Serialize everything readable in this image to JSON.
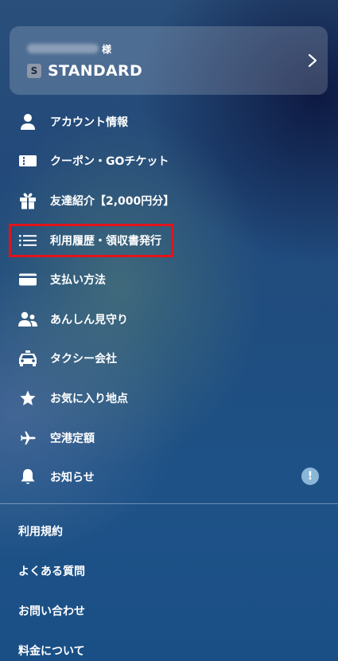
{
  "account": {
    "honorific": "様",
    "plan_badge": "S",
    "plan_name": "STANDARD"
  },
  "menu": {
    "items": [
      {
        "icon": "person-icon",
        "label": "アカウント情報"
      },
      {
        "icon": "ticket-icon",
        "label": "クーポン・GOチケット"
      },
      {
        "icon": "gift-icon",
        "label": "友達紹介【2,000円分】"
      },
      {
        "icon": "list-icon",
        "label": "利用履歴・領収書発行"
      },
      {
        "icon": "credit-card-icon",
        "label": "支払い方法"
      },
      {
        "icon": "people-icon",
        "label": "あんしん見守り"
      },
      {
        "icon": "taxi-icon",
        "label": "タクシー会社"
      },
      {
        "icon": "star-icon",
        "label": "お気に入り地点"
      },
      {
        "icon": "airplane-icon",
        "label": "空港定額"
      },
      {
        "icon": "bell-icon",
        "label": "お知らせ",
        "badge": "!"
      }
    ]
  },
  "footer": {
    "links": [
      "利用規約",
      "よくある質問",
      "お問い合わせ",
      "料金について"
    ]
  },
  "colors": {
    "highlight": "#e3131b",
    "badge": "#8ab6d8"
  }
}
